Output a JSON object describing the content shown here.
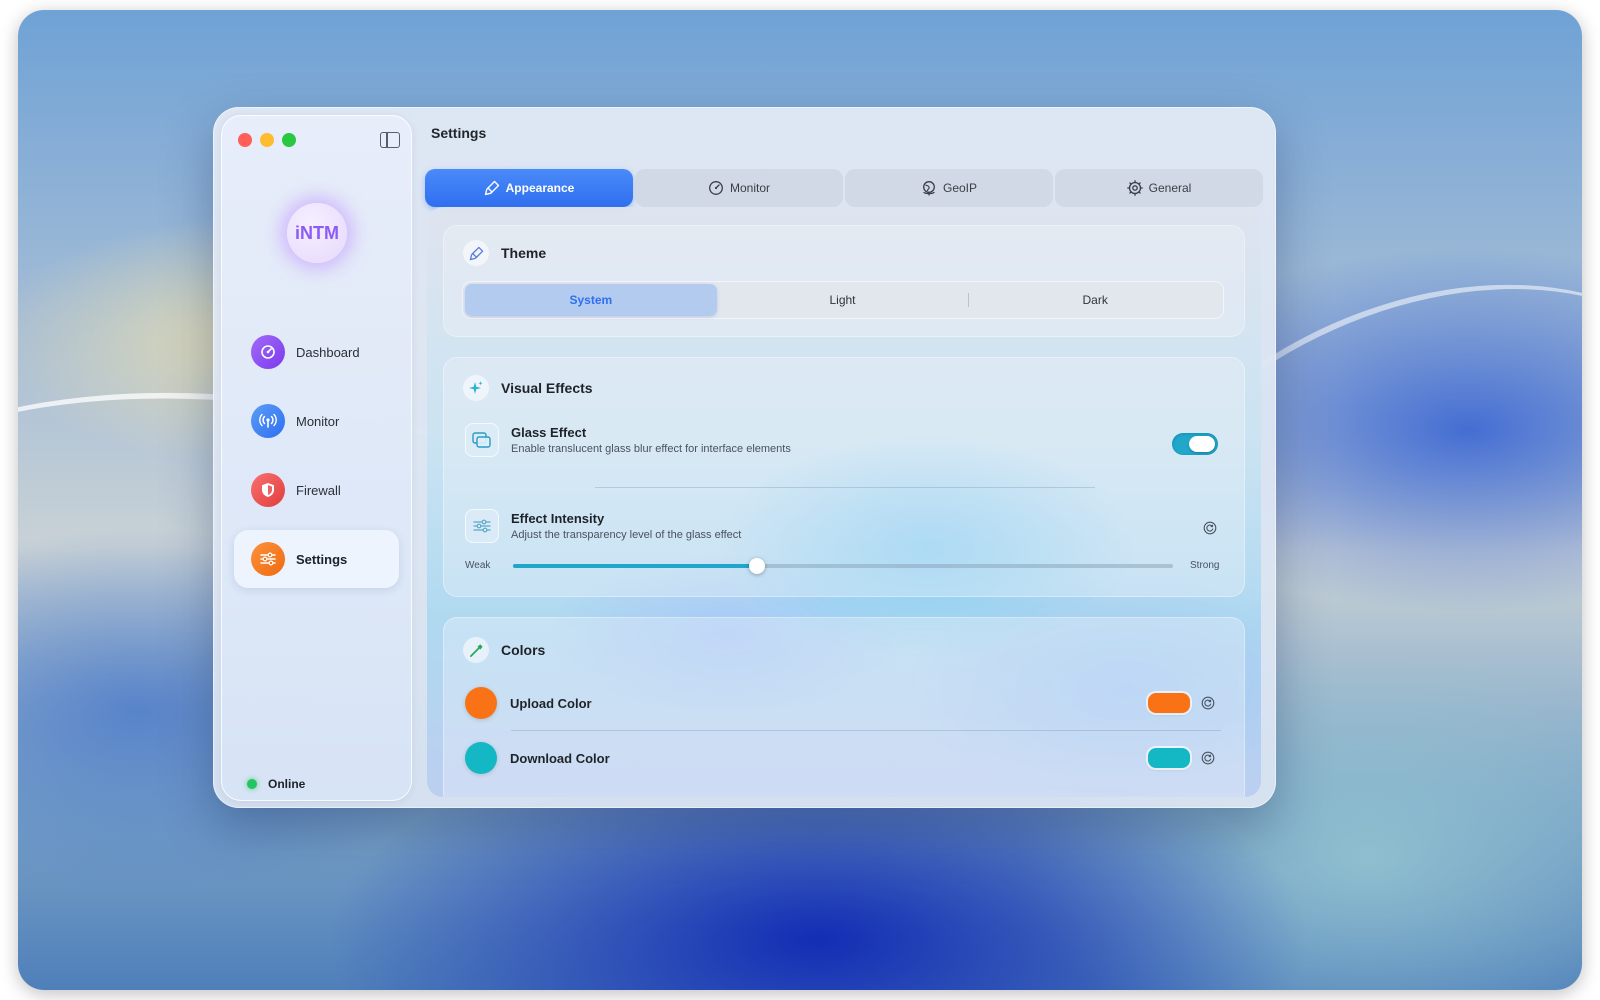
{
  "app": {
    "logo_text": "iNTM",
    "status_label": "Online"
  },
  "sidebar": {
    "items": [
      {
        "label": "Dashboard",
        "icon": "gauge-icon",
        "color": "#8b5cf6"
      },
      {
        "label": "Monitor",
        "icon": "antenna-icon",
        "color": "#3b82f6"
      },
      {
        "label": "Firewall",
        "icon": "shield-icon",
        "color": "#ef4444"
      },
      {
        "label": "Settings",
        "icon": "sliders-icon",
        "color": "#f97316",
        "active": true
      }
    ]
  },
  "page": {
    "title": "Settings"
  },
  "tabs": [
    {
      "label": "Appearance",
      "icon": "paintbrush-icon",
      "active": true
    },
    {
      "label": "Monitor",
      "icon": "gauge-icon"
    },
    {
      "label": "GeoIP",
      "icon": "globe-icon"
    },
    {
      "label": "General",
      "icon": "gear-icon"
    }
  ],
  "theme": {
    "title": "Theme",
    "options": [
      "System",
      "Light",
      "Dark"
    ],
    "selected": "System"
  },
  "visual_effects": {
    "title": "Visual Effects",
    "glass_effect": {
      "title": "Glass Effect",
      "description": "Enable translucent glass blur effect for interface elements",
      "enabled": true
    },
    "effect_intensity": {
      "title": "Effect Intensity",
      "description": "Adjust the transparency level of the glass effect",
      "min_label": "Weak",
      "max_label": "Strong",
      "value": 0.37
    }
  },
  "colors": {
    "title": "Colors",
    "upload": {
      "label": "Upload Color",
      "color": "#f97316"
    },
    "download": {
      "label": "Download Color",
      "color": "#14b8c4"
    }
  }
}
